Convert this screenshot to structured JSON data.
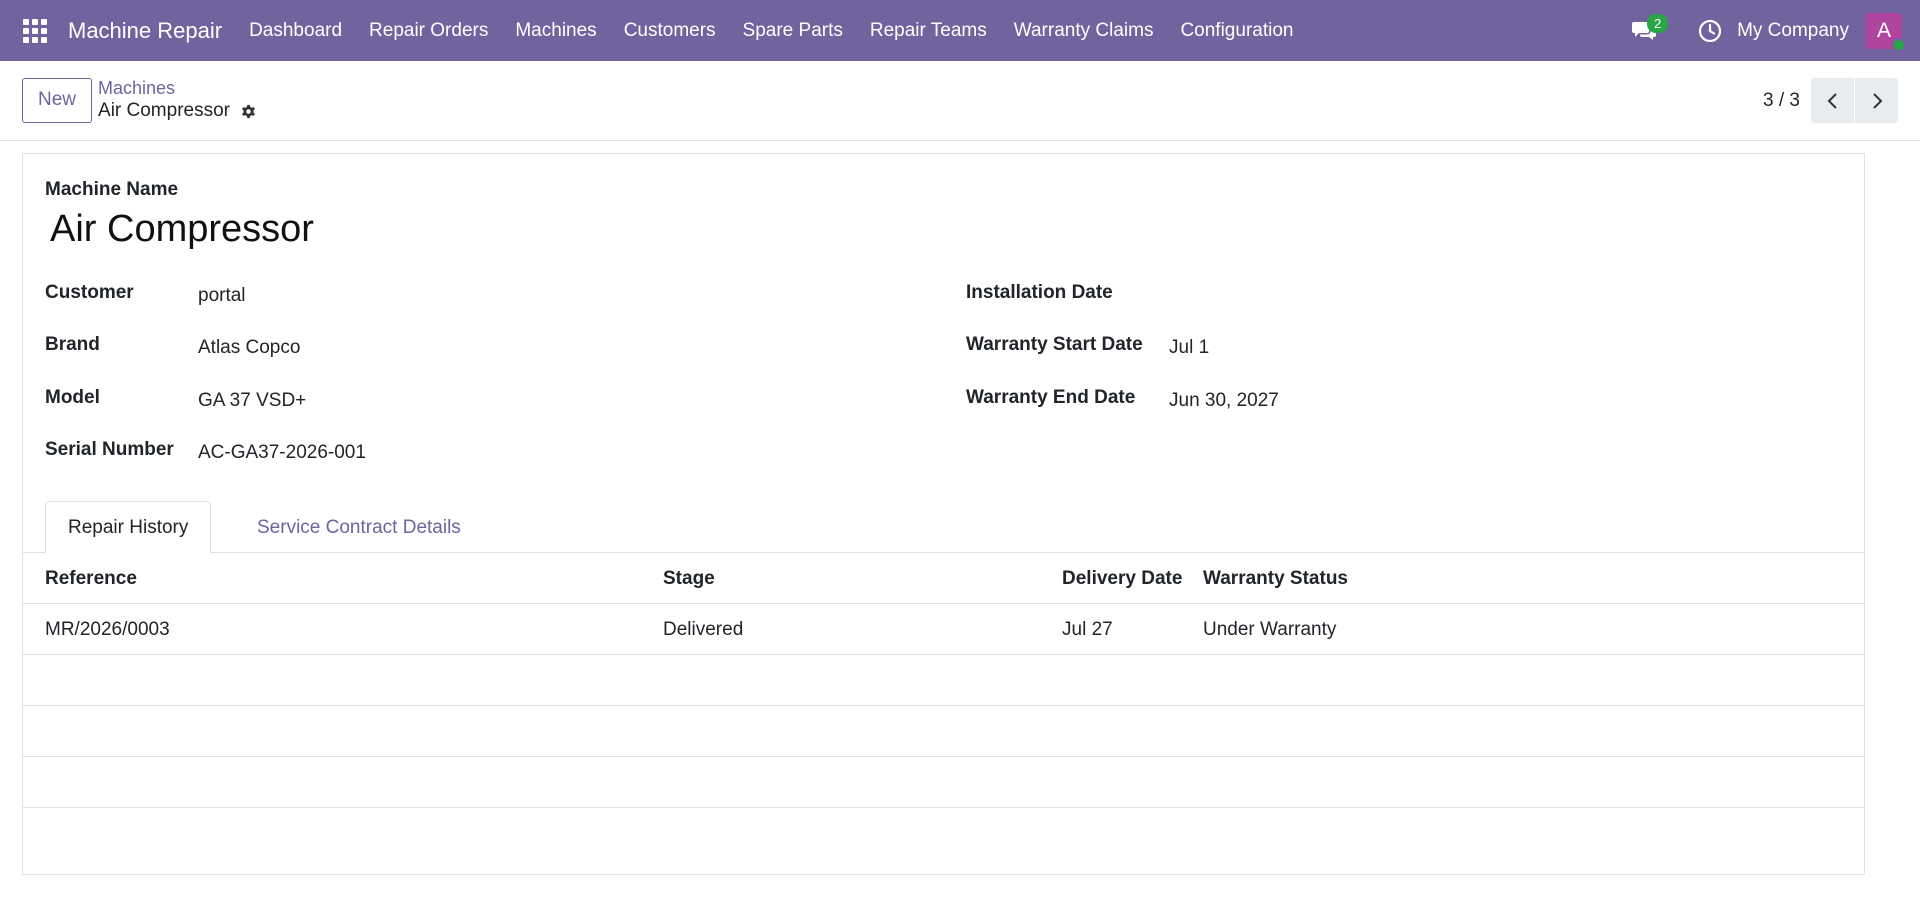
{
  "nav": {
    "app_name": "Machine Repair",
    "menu": [
      {
        "label": "Dashboard"
      },
      {
        "label": "Repair Orders"
      },
      {
        "label": "Machines"
      },
      {
        "label": "Customers"
      },
      {
        "label": "Spare Parts"
      },
      {
        "label": "Repair Teams"
      },
      {
        "label": "Warranty Claims"
      },
      {
        "label": "Configuration"
      }
    ],
    "messages_count": "2",
    "company": "My Company",
    "avatar_initial": "A",
    "colors": {
      "bar": "#71639e",
      "badge": "#28a745",
      "avatar": "#b0459e"
    }
  },
  "control": {
    "new_label": "New",
    "breadcrumb_parent": "Machines",
    "breadcrumb_current": "Air Compressor",
    "pager_value": "3 / 3"
  },
  "form": {
    "name_label": "Machine Name",
    "name_value": "Air Compressor",
    "left_fields": [
      {
        "label": "Customer",
        "value": "portal"
      },
      {
        "label": "Brand",
        "value": "Atlas Copco"
      },
      {
        "label": "Model",
        "value": "GA 37 VSD+"
      },
      {
        "label": "Serial Number",
        "value": "AC-GA37-2026-001"
      }
    ],
    "right_fields": [
      {
        "label": "Installation Date",
        "value": ""
      },
      {
        "label": "Warranty Start Date",
        "value": "Jul 1"
      },
      {
        "label": "Warranty End Date",
        "value": "Jun 30, 2027"
      }
    ]
  },
  "tabs": [
    {
      "label": "Repair History",
      "active": true
    },
    {
      "label": "Service Contract Details",
      "active": false
    }
  ],
  "repair_table": {
    "columns": [
      "Reference",
      "Stage",
      "Delivery Date",
      "Warranty Status"
    ],
    "rows": [
      {
        "reference": "MR/2026/0003",
        "stage": "Delivered",
        "delivery_date": "Jul 27",
        "warranty_status": "Under Warranty"
      }
    ]
  }
}
